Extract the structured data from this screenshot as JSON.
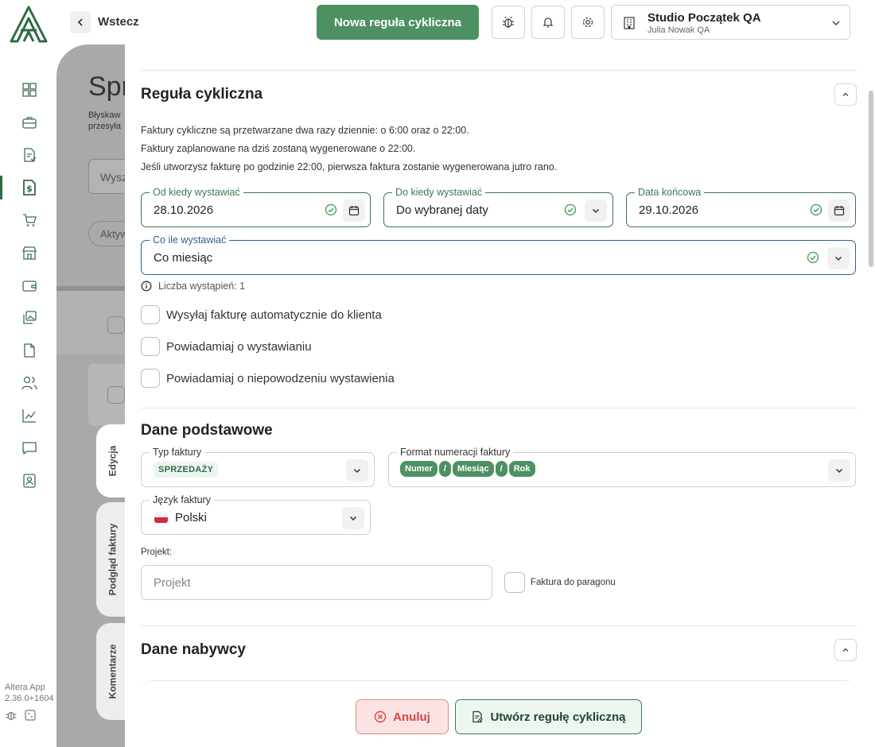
{
  "header": {
    "back_label": "Wstecz",
    "new_rule_label": "Nowa reguła cykliczna",
    "company_name": "Studio Początek QA",
    "company_user": "Julia Nowak QA"
  },
  "sidebar": {
    "items": [
      "grid-icon",
      "briefcase-icon",
      "invoice-icon",
      "dollar-document-icon",
      "cart-icon",
      "store-icon",
      "wallet-icon",
      "images-icon",
      "file-icon",
      "users-icon",
      "chart-icon",
      "message-icon",
      "user-badge-icon"
    ],
    "version_app": "Altera App",
    "version_num": "2.36.0+1604"
  },
  "background_page": {
    "title": "Spr",
    "subtitle_line1": "Błyskaw",
    "subtitle_line2": "przesyła",
    "search_placeholder": "Wysz",
    "chip": "Aktyw"
  },
  "tabs": {
    "edit": "Edycja",
    "preview": "Podgląd faktury",
    "comments": "Komentarze"
  },
  "recurring": {
    "title": "Reguła cykliczna",
    "info1": "Faktury cykliczne są przetwarzane dwa razy dziennie: o 6:00 oraz o 22:00.",
    "info2": "Faktury zaplanowane na dziś zostaną wygenerowane o 22:00.",
    "info3": "Jeśli utworzysz fakturę po godzinie 22:00, pierwsza faktura zostanie wygenerowana jutro rano.",
    "from_label": "Od kiedy wystawiać",
    "from_value": "28.10.2026",
    "until_label": "Do kiedy wystawiać",
    "until_value": "Do wybranej daty",
    "end_label": "Data końcowa",
    "end_value": "29.10.2026",
    "freq_label": "Co ile wystawiać",
    "freq_value": "Co miesiąc",
    "occurrences": "Liczba wystąpień: 1",
    "chk_send": "Wysyłaj fakturę automatycznie do klienta",
    "chk_notify": "Powiadamiaj o wystawianiu",
    "chk_fail": "Powiadamiaj o niepowodzeniu wystawienia"
  },
  "basic": {
    "title": "Dane podstawowe",
    "type_label": "Typ faktury",
    "type_value": "SPRZEDAŻY",
    "format_label": "Format numeracji faktury",
    "format_tokens": [
      "Numer",
      "/",
      "Miesiąc",
      "/",
      "Rok"
    ],
    "lang_label": "Język faktury",
    "lang_value": "Polski",
    "project_label": "Projekt:",
    "project_placeholder": "Projekt",
    "receipt_label": "Faktura do paragonu"
  },
  "buyer": {
    "title": "Dane nabywcy"
  },
  "actions": {
    "cancel": "Anuluj",
    "create": "Utwórz regułę cykliczną"
  },
  "colors": {
    "primary": "#4d9162",
    "danger": "#d64545",
    "field_ok": "#3f6f4f",
    "field_focus": "#35608c"
  }
}
